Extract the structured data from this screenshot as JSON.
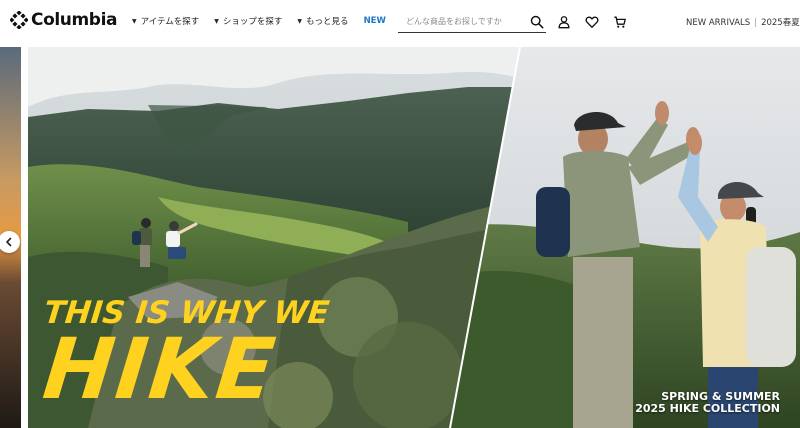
{
  "brand": {
    "name": "Columbia"
  },
  "nav": {
    "items": [
      {
        "label": "アイテムを探す"
      },
      {
        "label": "ショップを探す"
      },
      {
        "label": "もっと見る"
      }
    ],
    "new_label": "NEW"
  },
  "search": {
    "placeholder": "どんな商品をお探しですか"
  },
  "header_icons": [
    "search-icon",
    "account-icon",
    "wishlist-icon",
    "cart-icon"
  ],
  "promo": {
    "new_arrivals": "NEW ARRIVALS",
    "separator": "|",
    "season": "2025春夏"
  },
  "hero": {
    "headline_line1": "THIS IS WHY WE",
    "headline_line2": "HIKE",
    "collection_line1": "SPRING & SUMMER",
    "collection_line2": "2025 HIKE COLLECTION"
  },
  "colors": {
    "accent_yellow": "#ffd21f",
    "new_blue": "#1b78c8"
  }
}
